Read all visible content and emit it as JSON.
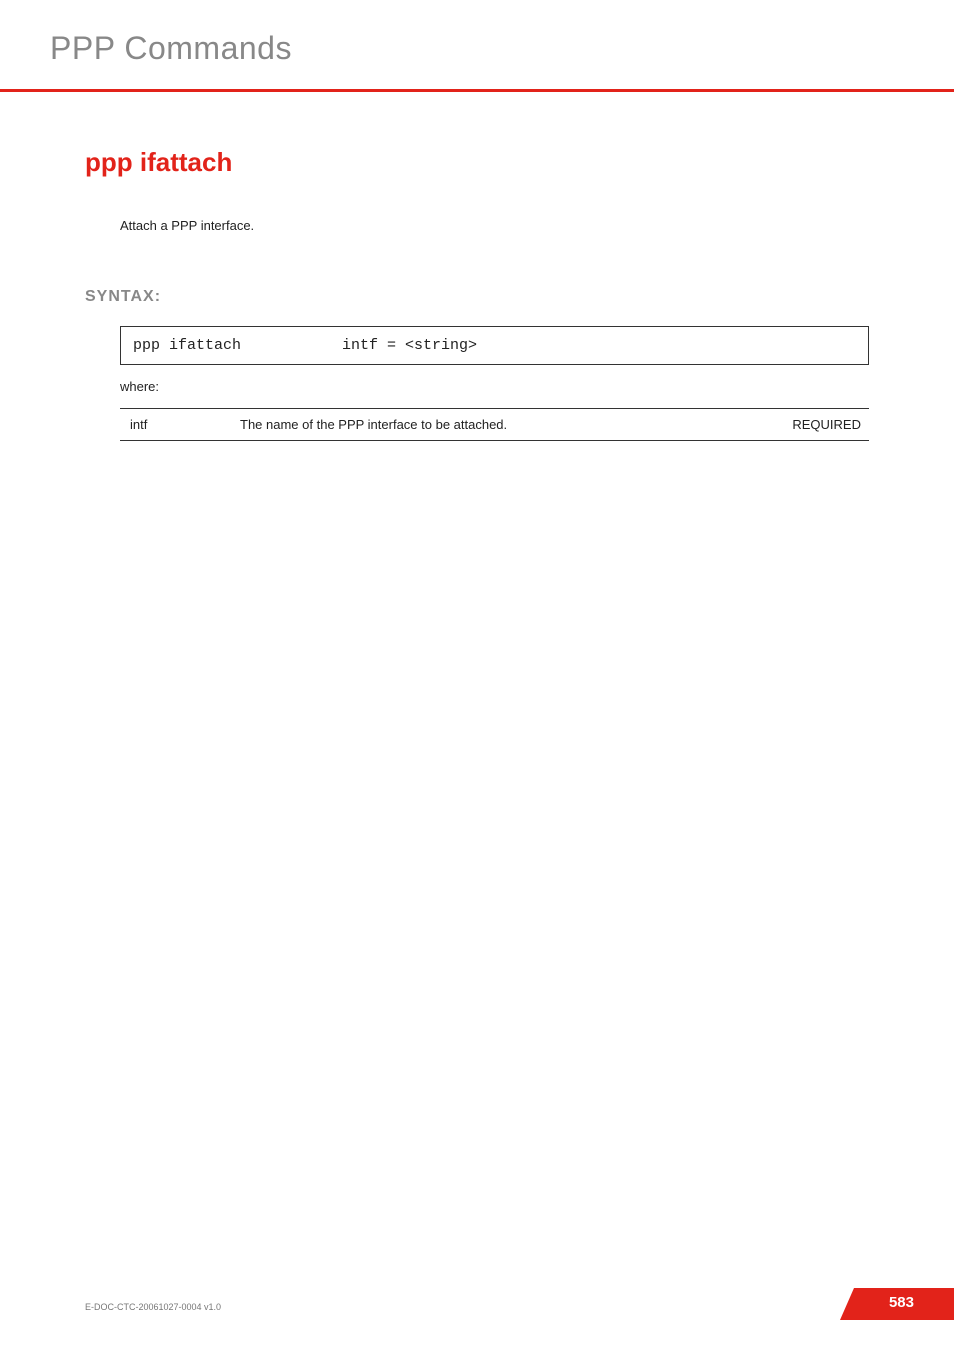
{
  "header": {
    "title": "PPP Commands"
  },
  "command": {
    "heading": "ppp ifattach",
    "description": "Attach a PPP interface."
  },
  "syntax": {
    "label": "SYNTAX:",
    "cmd": "ppp ifattach",
    "args": "intf = <string>",
    "where": "where:"
  },
  "params": [
    {
      "name": "intf",
      "desc": "The name of the PPP interface to be attached.",
      "req": "REQUIRED"
    }
  ],
  "footer": {
    "docid": "E-DOC-CTC-20061027-0004 v1.0",
    "page": "583"
  }
}
